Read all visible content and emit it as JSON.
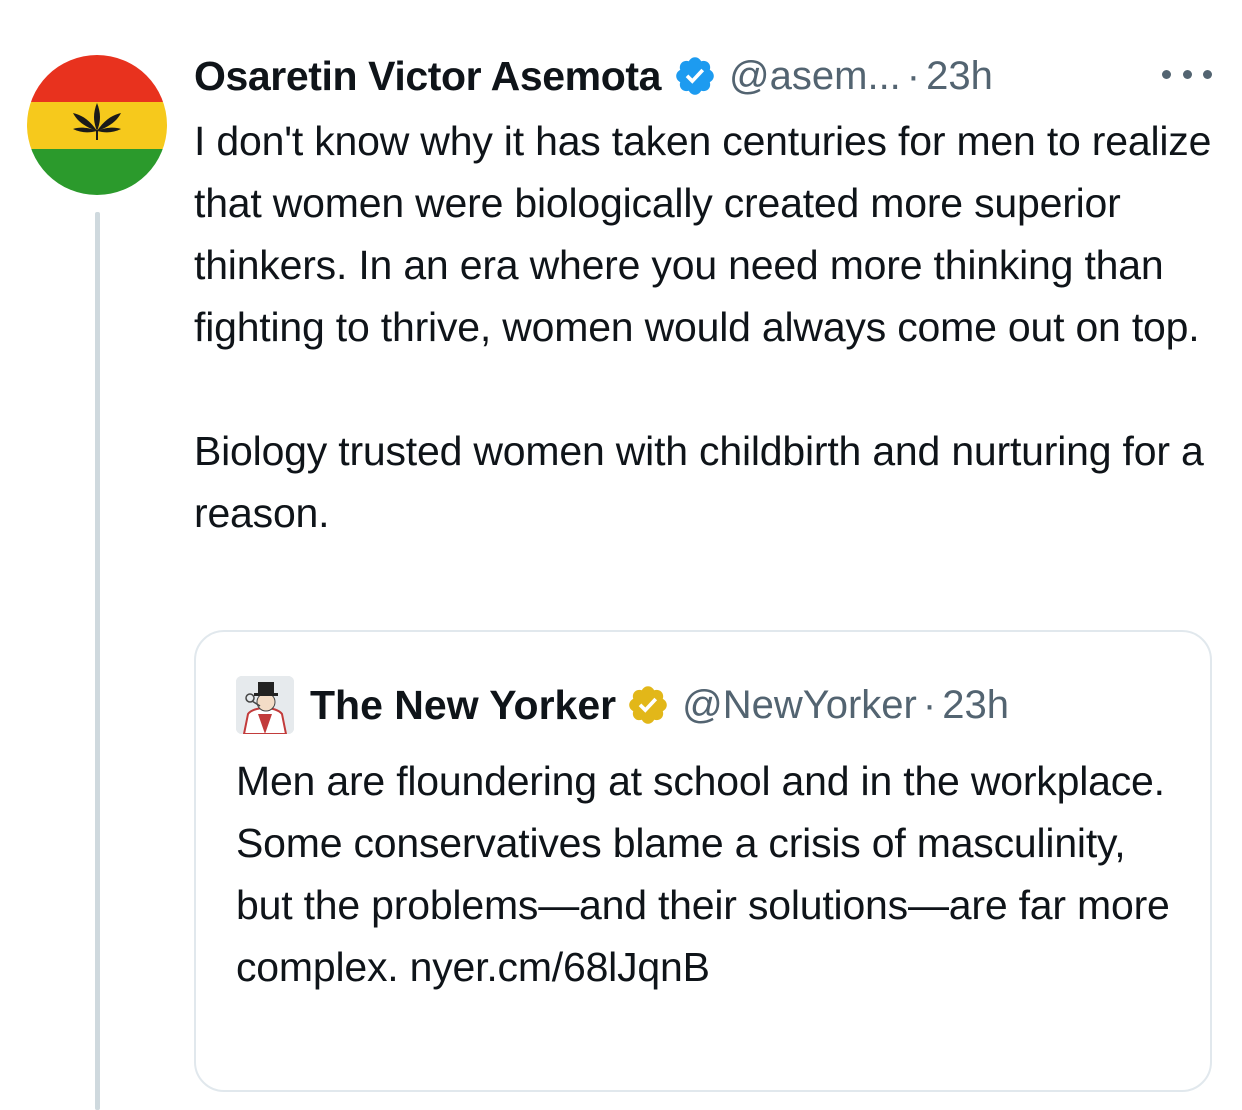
{
  "tweet": {
    "author_name": "Osaretin Victor Asemota",
    "handle": "@asem...",
    "separator": "·",
    "time": "23h",
    "verified_icon": "verified-badge-blue",
    "more_icon": "more-icon",
    "text_paragraphs": [
      "I don't know why it has taken centuries for men to realize that women were biologically created more superior thinkers. In an era where you need more thinking than fighting to thrive, women would always come out on top.",
      "Biology trusted women with childbirth and nurturing for a reason."
    ],
    "avatar_colors": [
      "#e8321e",
      "#f6c91c",
      "#2b9a2c"
    ]
  },
  "quote": {
    "author_name": "The New Yorker",
    "handle": "@NewYorker",
    "separator": "·",
    "time": "23h",
    "verified_icon": "verified-badge-gold",
    "text": "Men are floundering at school and in the workplace. Some conservatives blame a crisis of masculinity, but the problems—and their solutions—are far more complex. nyer.cm/68lJqnB"
  },
  "colors": {
    "verified_blue": "#1d9bf0",
    "verified_gold": "#e2b719",
    "secondary_text": "#536471",
    "border": "#e1e8ed"
  }
}
